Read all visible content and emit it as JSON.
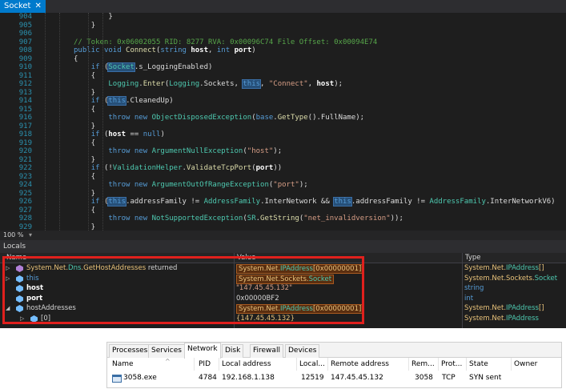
{
  "ide": {
    "tab_label": "Socket",
    "tab_close": "✕",
    "zoom": "100 %",
    "caret": "▾",
    "locals_title": "Locals",
    "columns": {
      "name": "Name",
      "value": "Value",
      "type": "Type"
    },
    "code_lines": [
      {
        "n": "904",
        "html": "        <span>}</span>"
      },
      {
        "n": "905",
        "html": "    <span>}</span>"
      },
      {
        "n": "906",
        "html": ""
      },
      {
        "n": "907",
        "html": "<span class=\"cm\">// Token: 0x06002055 RID: 8277 RVA: 0x00096C74 File Offset: 0x00094E74</span>"
      },
      {
        "n": "908",
        "html": "<span class=\"kw\">public</span> <span class=\"kw\">void</span> <span class=\"mt\">Connect</span>(<span class=\"kw\">string</span> <span class=\"pm\">host</span>, <span class=\"kw\">int</span> <span class=\"pm\">port</span>)"
      },
      {
        "n": "909",
        "html": "{"
      },
      {
        "n": "910",
        "html": "    <span class=\"kw\">if</span> (<span class=\"ty hl\">Socket</span>.s_LoggingEnabled)"
      },
      {
        "n": "911",
        "html": "    {"
      },
      {
        "n": "912",
        "html": "        <span class=\"ty\">Logging</span>.<span class=\"mt\">Enter</span>(<span class=\"ty\">Logging</span>.Sockets, <span class=\"kw hl\">this</span>, <span class=\"str\">\"Connect\"</span>, <span class=\"pm\">host</span>);"
      },
      {
        "n": "913",
        "html": "    }"
      },
      {
        "n": "914",
        "html": "    <span class=\"kw\">if</span> (<span class=\"kw hl\">this</span>.CleanedUp)"
      },
      {
        "n": "915",
        "html": "    {"
      },
      {
        "n": "916",
        "html": "        <span class=\"kw\">throw</span> <span class=\"kw\">new</span> <span class=\"ty\">ObjectDisposedException</span>(<span class=\"kw\">base</span>.<span class=\"mt\">GetType</span>().FullName);"
      },
      {
        "n": "917",
        "html": "    }"
      },
      {
        "n": "918",
        "html": "    <span class=\"kw\">if</span> (<span class=\"pm\">host</span> == <span class=\"kw\">null</span>)"
      },
      {
        "n": "919",
        "html": "    {"
      },
      {
        "n": "920",
        "html": "        <span class=\"kw\">throw</span> <span class=\"kw\">new</span> <span class=\"ty\">ArgumentNullException</span>(<span class=\"str\">\"host\"</span>);"
      },
      {
        "n": "921",
        "html": "    }"
      },
      {
        "n": "922",
        "html": "    <span class=\"kw\">if</span> (!<span class=\"ty\">ValidationHelper</span>.<span class=\"mt\">ValidateTcpPort</span>(<span class=\"pm\">port</span>))"
      },
      {
        "n": "923",
        "html": "    {"
      },
      {
        "n": "924",
        "html": "        <span class=\"kw\">throw</span> <span class=\"kw\">new</span> <span class=\"ty\">ArgumentOutOfRangeException</span>(<span class=\"str\">\"port\"</span>);"
      },
      {
        "n": "925",
        "html": "    }"
      },
      {
        "n": "926",
        "html": "    <span class=\"kw\">if</span> (<span class=\"kw hl\">this</span>.addressFamily != <span class=\"ty\">AddressFamily</span>.InterNetwork &amp;&amp; <span class=\"kw hl\">this</span>.addressFamily != <span class=\"ty\">AddressFamily</span>.InterNetworkV6)"
      },
      {
        "n": "927",
        "html": "    {"
      },
      {
        "n": "928",
        "html": "        <span class=\"kw\">throw</span> <span class=\"kw\">new</span> <span class=\"ty\">NotSupportedException</span>(<span class=\"ty\">SR</span>.<span class=\"mt\">GetString</span>(<span class=\"str\">\"net_invalidversion\"</span>));"
      },
      {
        "n": "929",
        "html": "    }"
      }
    ],
    "locals": [
      {
        "arrow": "▷",
        "icon": "method-return-icon",
        "name_html": "<span class=\"c-yellow\">System.Net.</span><span class=\"c-cyan\">Dns</span><span class=\"c-yellow\">.</span><span class=\"c-yellow\">GetHostAddresses</span><span style=\"position:static;color:#d4d4d4\"> returned</span>",
        "value_html": "<span class=\"c-yellow\">System.Net.</span><span class=\"c-cyan\">IPAddress</span><span class=\"c-yellow\">[0x00000001]</span>",
        "value_boxed": true,
        "type_html": "<span class=\"c-yellow\">System.Net.</span><span class=\"c-cyan\">IPAddress</span><span class=\"c-yellow\">[]</span>"
      },
      {
        "arrow": "▷",
        "icon": "object-icon",
        "name_html": "<span class=\"c-blue\">this</span>",
        "value_html": "<span class=\"c-yellow\">System.Net.Sockets.</span><span class=\"c-cyan\">Socket</span>",
        "value_boxed": true,
        "type_html": "<span class=\"c-yellow\">System.Net.Sockets.</span><span class=\"c-cyan\">Socket</span>"
      },
      {
        "arrow": "",
        "icon": "field-icon",
        "name_html": "<span class=\"c-white\">host</span>",
        "value_html": "<span class=\"c-str\">\"147.45.45.132\"</span>",
        "value_boxed": false,
        "type_html": "<span class=\"c-blue\">string</span>"
      },
      {
        "arrow": "",
        "icon": "field-icon",
        "name_html": "<span class=\"c-white\">port</span>",
        "value_html": "<span style=\"position:static;color:#d4d4d4\">0x00000BF2</span>",
        "value_boxed": false,
        "type_html": "<span class=\"c-blue\">int</span>"
      },
      {
        "arrow": "◢",
        "icon": "local-icon",
        "name_html": "<span style=\"position:static;color:#d4d4d4\">hostAddresses</span>",
        "value_html": "<span class=\"c-yellow\">System.Net.</span><span class=\"c-cyan\">IPAddress</span><span class=\"c-yellow\">[0x00000001]</span>",
        "value_boxed": true,
        "type_html": "<span class=\"c-yellow\">System.Net.</span><span class=\"c-cyan\">IPAddress</span><span class=\"c-yellow\">[]</span>"
      },
      {
        "arrow": "▷",
        "icon": "element-icon",
        "name_html": "<span style=\"position:static;color:#d4d4d4\">[0]</span>",
        "value_html": "<span style=\"position:static;color:#e8c27a\">{147.45.45.132}</span>",
        "value_boxed": false,
        "type_html": "<span class=\"c-yellow\">System.Net.</span><span class=\"c-cyan\">IPAddress</span>"
      }
    ]
  },
  "taskmgr": {
    "tabs": [
      "Processes",
      "Services",
      "Network",
      "Disk",
      "Firewall",
      "Devices"
    ],
    "active_tab": "Network",
    "headers": {
      "name": "Name",
      "pid": "PID",
      "local_address": "Local address",
      "local_port": "Local...",
      "remote_address": "Remote address",
      "remote_port": "Rem...",
      "protocol": "Prot...",
      "state": "State",
      "owner": "Owner",
      "sort_caret": "^"
    },
    "row": {
      "name": "3058.exe",
      "pid": "4784",
      "local_address": "192.168.1.138",
      "local_port": "12519",
      "remote_address": "147.45.45.132",
      "remote_port": "3058",
      "protocol": "TCP",
      "state": "SYN sent",
      "owner": ""
    }
  }
}
